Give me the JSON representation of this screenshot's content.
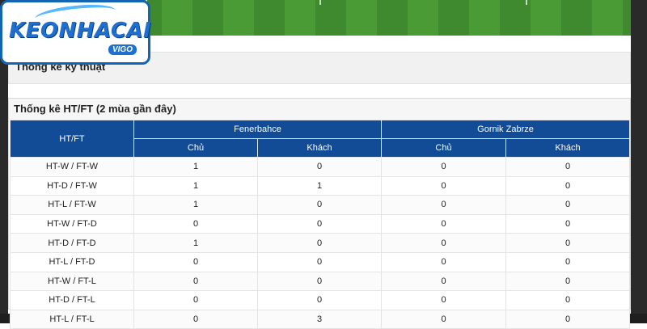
{
  "logo": {
    "text": "KEONHACAI",
    "sub": "VIGO"
  },
  "tech_section": {
    "title": "Thống kê kỹ thuật"
  },
  "htft": {
    "title": "Thống kê HT/FT (2 mùa gần đây)",
    "header_first": "HT/FT",
    "team1": "Fenerbahce",
    "team2": "Gornik Zabrze",
    "sub_home": "Chủ",
    "sub_away": "Khách",
    "rows": [
      {
        "label": "HT-W / FT-W",
        "v": [
          "1",
          "0",
          "0",
          "0"
        ]
      },
      {
        "label": "HT-D / FT-W",
        "v": [
          "1",
          "1",
          "0",
          "0"
        ]
      },
      {
        "label": "HT-L / FT-W",
        "v": [
          "1",
          "0",
          "0",
          "0"
        ]
      },
      {
        "label": "HT-W / FT-D",
        "v": [
          "0",
          "0",
          "0",
          "0"
        ]
      },
      {
        "label": "HT-D / FT-D",
        "v": [
          "1",
          "0",
          "0",
          "0"
        ]
      },
      {
        "label": "HT-L / FT-D",
        "v": [
          "0",
          "0",
          "0",
          "0"
        ]
      },
      {
        "label": "HT-W / FT-L",
        "v": [
          "0",
          "0",
          "0",
          "0"
        ]
      },
      {
        "label": "HT-D / FT-L",
        "v": [
          "0",
          "0",
          "0",
          "0"
        ]
      },
      {
        "label": "HT-L / FT-L",
        "v": [
          "0",
          "3",
          "0",
          "0"
        ]
      }
    ]
  }
}
